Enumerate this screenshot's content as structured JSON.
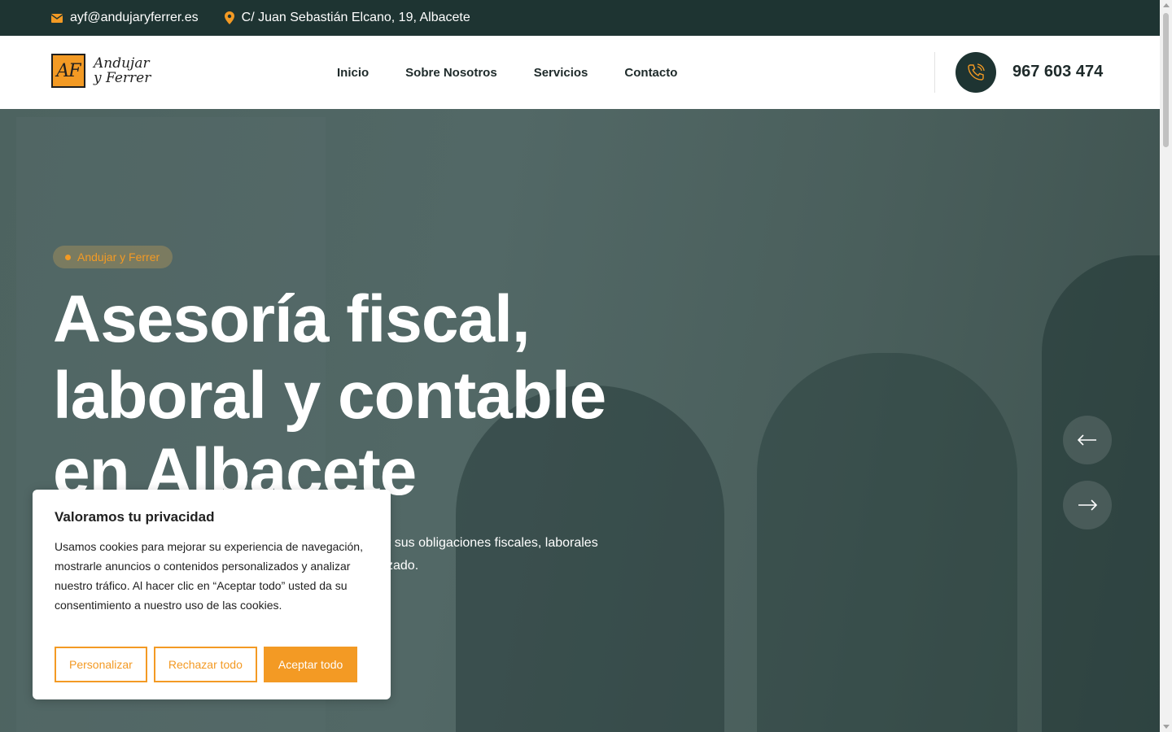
{
  "topbar": {
    "email": "ayf@andujaryferrer.es",
    "address": "C/ Juan Sebastián Elcano, 19, Albacete"
  },
  "header": {
    "logo_mark": "AF",
    "logo_line1": "Andujar",
    "logo_line2": "y Ferrer",
    "nav": [
      "Inicio",
      "Sobre Nosotros",
      "Servicios",
      "Contacto"
    ],
    "phone": "967 603 474"
  },
  "hero": {
    "pill": "Andujar y Ferrer",
    "title_line1": "Asesoría fiscal,",
    "title_line2": "laboral y contable",
    "title_line3": "en Albacete",
    "subtitle_line1": "r sus obligaciones fiscales, laborales",
    "subtitle_line2": "zado."
  },
  "cookie": {
    "title": "Valoramos tu privacidad",
    "text": "Usamos cookies para mejorar su experiencia de navegación, mostrarle anuncios o contenidos personalizados y analizar nuestro tráfico. Al hacer clic en “Aceptar todo” usted da su consentimiento a nuestro uso de las cookies.",
    "customize": "Personalizar",
    "reject": "Rechazar todo",
    "accept": "Aceptar todo"
  },
  "colors": {
    "accent": "#f39a24",
    "dark": "#1e3432"
  }
}
